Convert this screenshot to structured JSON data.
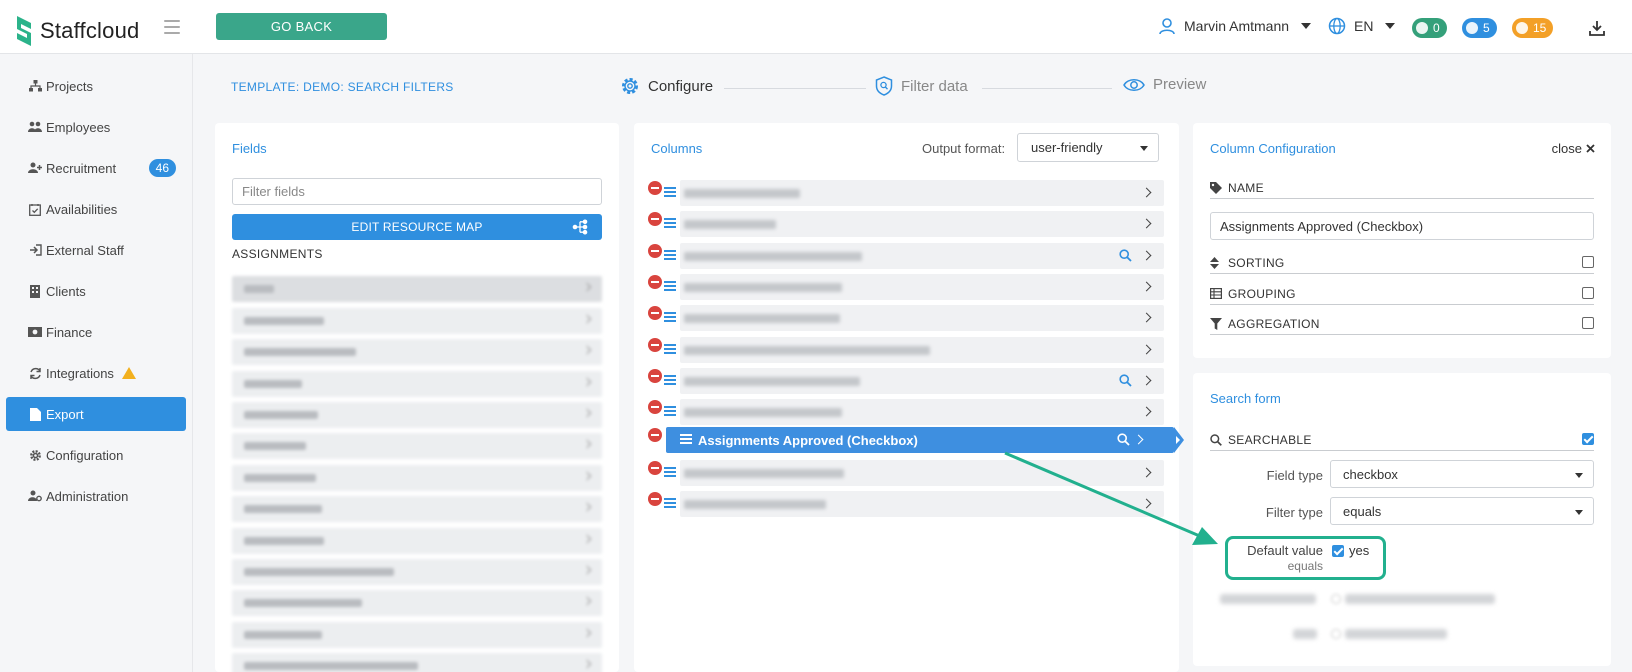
{
  "app": {
    "name": "Staffcloud",
    "go_back_label": "GO BACK",
    "user_name": "Marvin Amtmann",
    "language": "EN",
    "badges": {
      "messages": "0",
      "notifications": "5",
      "timers": "15"
    },
    "colors": {
      "accent": "#2f8fdf",
      "go_back": "#3aa68a",
      "danger": "#d9443e",
      "highlight": "#22b08e"
    }
  },
  "sidebar": {
    "items": [
      {
        "label": "Projects",
        "icon": "sitemap-icon"
      },
      {
        "label": "Employees",
        "icon": "users-icon"
      },
      {
        "label": "Recruitment",
        "icon": "user-plus-icon",
        "count": "46"
      },
      {
        "label": "Availabilities",
        "icon": "calendar-check-icon"
      },
      {
        "label": "External Staff",
        "icon": "sign-in-icon"
      },
      {
        "label": "Clients",
        "icon": "building-icon"
      },
      {
        "label": "Finance",
        "icon": "money-icon"
      },
      {
        "label": "Integrations",
        "icon": "sync-icon",
        "warning": true
      },
      {
        "label": "Export",
        "icon": "file-icon",
        "active": true
      },
      {
        "label": "Configuration",
        "icon": "gear-icon"
      },
      {
        "label": "Administration",
        "icon": "user-gear-icon"
      }
    ]
  },
  "header": {
    "template_title": "TEMPLATE: DEMO: SEARCH FILTERS",
    "steps": [
      {
        "label": "Configure",
        "icon": "gear-icon",
        "active": true
      },
      {
        "label": "Filter data",
        "icon": "shield-search-icon",
        "active": false
      },
      {
        "label": "Preview",
        "icon": "eye-icon",
        "active": false
      }
    ]
  },
  "fields": {
    "title": "Fields",
    "filter_placeholder": "Filter fields",
    "edit_map_label": "EDIT RESOURCE MAP",
    "group_heading": "ASSIGNMENTS"
  },
  "columns": {
    "title": "Columns",
    "output_format_label": "Output format:",
    "output_format_value": "user-friendly",
    "active_column_label": "Assignments Approved (Checkbox)"
  },
  "column_config": {
    "title": "Column Configuration",
    "close_label": "close",
    "name_label": "NAME",
    "name_value": "Assignments Approved (Checkbox)",
    "sorting_label": "SORTING",
    "grouping_label": "GROUPING",
    "aggregation_label": "AGGREGATION"
  },
  "search_form": {
    "title": "Search form",
    "searchable_label": "SEARCHABLE",
    "field_type_label": "Field type",
    "field_type_value": "checkbox",
    "filter_type_label": "Filter type",
    "filter_type_value": "equals",
    "default_value_label": "Default value",
    "default_value_sub": "equals",
    "default_value_option": "yes"
  }
}
